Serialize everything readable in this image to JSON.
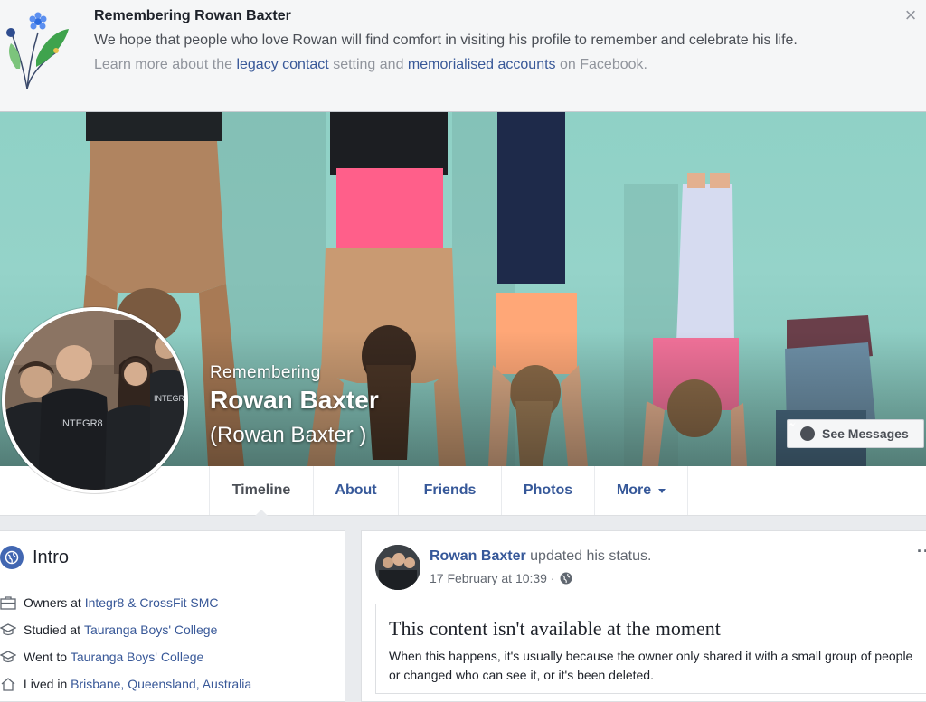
{
  "banner": {
    "title": "Remembering Rowan Baxter",
    "message": "We hope that people who love Rowan will find comfort in visiting his profile to remember and celebrate his life.",
    "learn_prefix": "Learn more about the",
    "legacy_link": "legacy contact",
    "learn_middle": "setting and",
    "memorial_link": "memorialised accounts",
    "learn_suffix": "on Facebook.",
    "close_label": "×"
  },
  "cover": {
    "remembering_label": "Remembering",
    "name": "Rowan Baxter",
    "alternate_name": "(Rowan Baxter )",
    "see_messages_label": "See Messages"
  },
  "tabs": [
    {
      "label": "Timeline",
      "active": true
    },
    {
      "label": "About"
    },
    {
      "label": "Friends"
    },
    {
      "label": "Photos"
    },
    {
      "label": "More"
    }
  ],
  "intro": {
    "title": "Intro",
    "items": [
      {
        "icon": "briefcase-icon",
        "prefix": "Owners at",
        "link": "Integr8 & CrossFit SMC"
      },
      {
        "icon": "graduation-cap-icon",
        "prefix": "Studied at",
        "link": "Tauranga Boys' College"
      },
      {
        "icon": "graduation-cap-icon",
        "prefix": "Went to",
        "link": "Tauranga Boys' College"
      },
      {
        "icon": "home-icon",
        "prefix": "Lived in",
        "link": "Brisbane, Queensland, Australia"
      }
    ]
  },
  "post": {
    "author": "Rowan Baxter",
    "action": "updated his status.",
    "date": "17 February at 10:39 ·",
    "more": "··",
    "unavailable_title": "This content isn't available at the moment",
    "unavailable_body": "When this happens, it's usually because the owner only shared it with a small group of people or changed who can see it, or it's been deleted."
  },
  "colors": {
    "link": "#385898",
    "tab_link": "#365899",
    "page_bg": "#e9ebee",
    "banner_bg": "#f5f6f7"
  }
}
